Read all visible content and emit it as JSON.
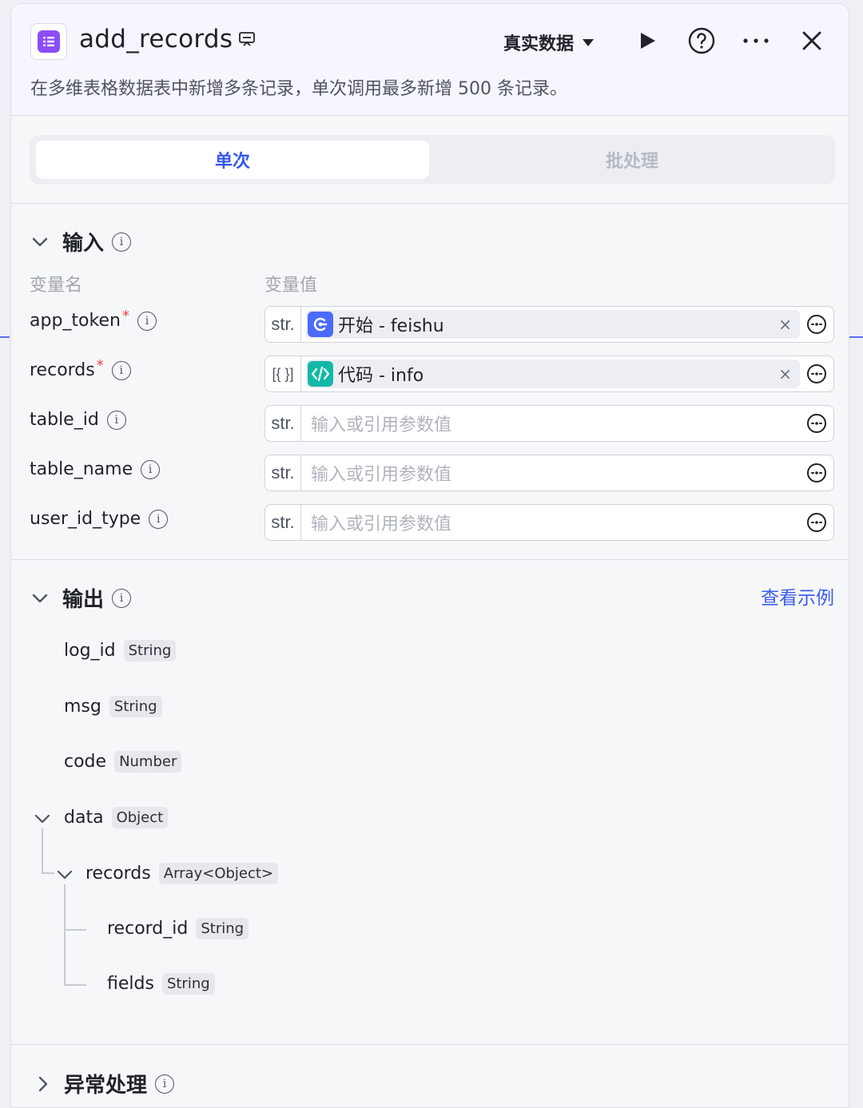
{
  "header": {
    "title": "add_records",
    "mode_label": "真实数据",
    "description": "在多维表格数据表中新增多条记录，单次调用最多新增 500 条记录。"
  },
  "tabs": [
    {
      "label": "单次",
      "active": true
    },
    {
      "label": "批处理",
      "active": false
    }
  ],
  "input": {
    "title": "输入",
    "col_name": "变量名",
    "col_value": "变量值",
    "placeholder": "输入或引用参数值",
    "rows": [
      {
        "name": "app_token",
        "required": true,
        "type": "str.",
        "ref": "开始 - feishu",
        "ref_icon": "start-node-icon"
      },
      {
        "name": "records",
        "required": true,
        "type": "[{ }]",
        "ref": "代码 - info",
        "ref_icon": "code-node-icon"
      },
      {
        "name": "table_id",
        "required": false,
        "type": "str."
      },
      {
        "name": "table_name",
        "required": false,
        "type": "str."
      },
      {
        "name": "user_id_type",
        "required": false,
        "type": "str."
      }
    ]
  },
  "output": {
    "title": "输出",
    "see_example": "查看示例",
    "fields": [
      {
        "name": "log_id",
        "type": "String"
      },
      {
        "name": "msg",
        "type": "String"
      },
      {
        "name": "code",
        "type": "Number"
      },
      {
        "name": "data",
        "type": "Object"
      },
      {
        "name": "records",
        "type": "Array<Object>"
      },
      {
        "name": "record_id",
        "type": "String"
      },
      {
        "name": "fields",
        "type": "String"
      }
    ]
  },
  "error_handling": {
    "title": "异常处理"
  },
  "colors": {
    "accent": "#3358f0",
    "brand_purple": "#8b4dfb",
    "code_teal": "#14b8a6",
    "required": "#f03e3e"
  }
}
